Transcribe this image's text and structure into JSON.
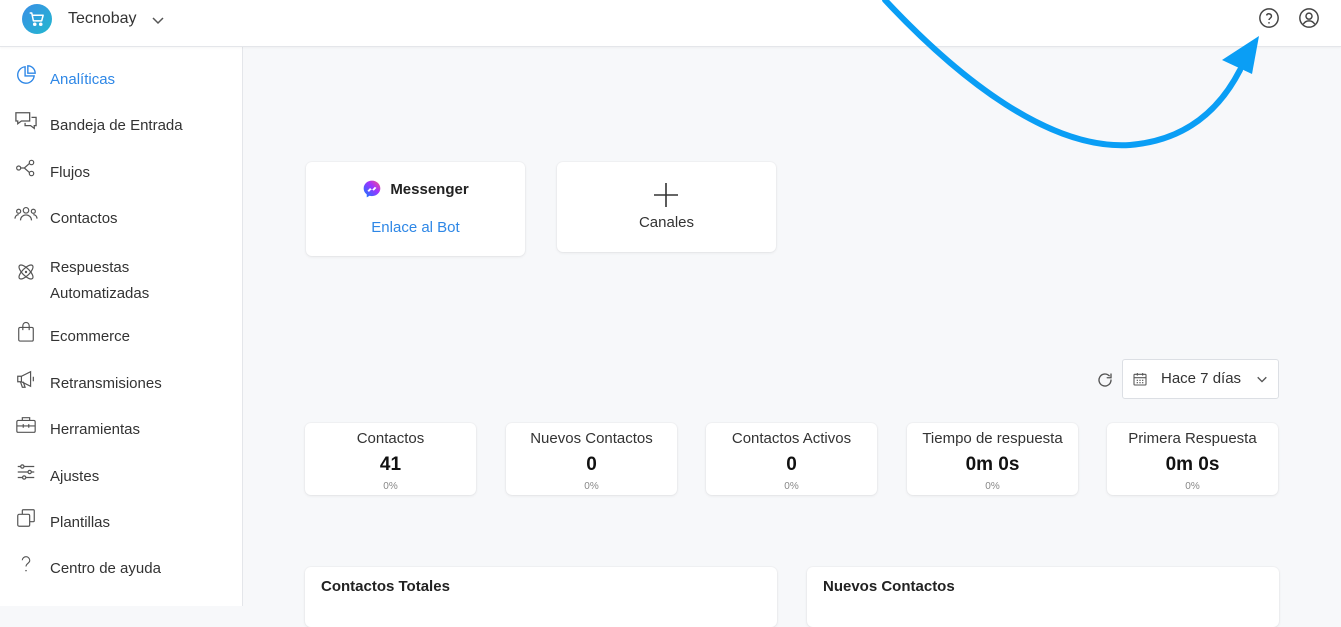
{
  "workspace": {
    "name": "Tecnobay"
  },
  "sidebar": {
    "items": [
      {
        "label": "Analíticas",
        "icon": "pie-chart-icon",
        "active": true
      },
      {
        "label": "Bandeja de Entrada",
        "icon": "chat-bubbles-icon"
      },
      {
        "label": "Flujos",
        "icon": "flow-nodes-icon"
      },
      {
        "label": "Contactos",
        "icon": "users-icon"
      },
      {
        "label": "Respuestas Automatizadas",
        "icon": "atom-icon"
      },
      {
        "label": "Ecommerce",
        "icon": "shopping-bag-icon"
      },
      {
        "label": "Retransmisiones",
        "icon": "megaphone-icon"
      },
      {
        "label": "Herramientas",
        "icon": "toolbox-icon"
      },
      {
        "label": "Ajustes",
        "icon": "sliders-icon"
      },
      {
        "label": "Plantillas",
        "icon": "copy-icon"
      },
      {
        "label": "Centro de ayuda",
        "icon": "question-icon"
      }
    ]
  },
  "channels": {
    "messenger": {
      "name": "Messenger",
      "link_label": "Enlace al Bot",
      "icon": "messenger-icon"
    },
    "add": {
      "label": "Canales",
      "icon": "plus-icon"
    }
  },
  "filters": {
    "date_range": "Hace 7 días"
  },
  "stats": [
    {
      "label": "Contactos",
      "value": "41",
      "change": "0%"
    },
    {
      "label": "Nuevos Contactos",
      "value": "0",
      "change": "0%"
    },
    {
      "label": "Contactos Activos",
      "value": "0",
      "change": "0%"
    },
    {
      "label": "Tiempo de respuesta",
      "value": "0m 0s",
      "change": "0%"
    },
    {
      "label": "Primera Respuesta",
      "value": "0m 0s",
      "change": "0%"
    }
  ],
  "panels": [
    {
      "title": "Contactos Totales"
    },
    {
      "title": "Nuevos Contactos"
    }
  ],
  "colors": {
    "accent": "#2e87e6",
    "annotation_arrow": "#0a9ef5"
  }
}
